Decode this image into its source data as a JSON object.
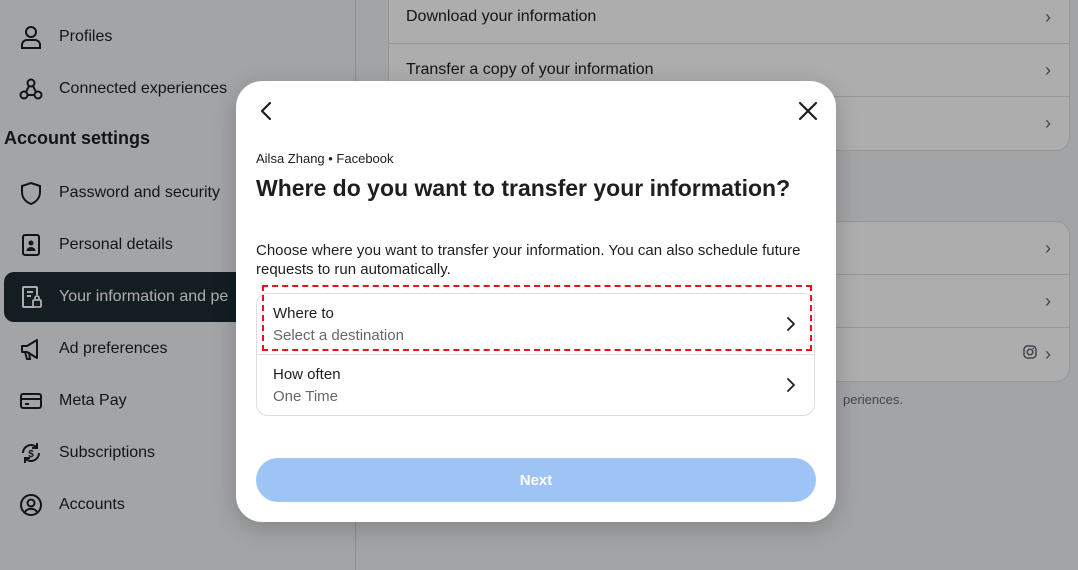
{
  "sidebar": {
    "items_top": [
      {
        "label": "Profiles",
        "icon": "person-icon"
      },
      {
        "label": "Connected experiences",
        "icon": "connected-experiences-icon"
      }
    ],
    "heading": "Account settings",
    "items": [
      {
        "label": "Password and security",
        "icon": "shield-icon"
      },
      {
        "label": "Personal details",
        "icon": "id-card-icon"
      },
      {
        "label": "Your information and pe",
        "icon": "document-lock-icon",
        "active": true
      },
      {
        "label": "Ad preferences",
        "icon": "megaphone-icon"
      },
      {
        "label": "Meta Pay",
        "icon": "credit-card-icon"
      },
      {
        "label": "Subscriptions",
        "icon": "dollar-refresh-icon"
      },
      {
        "label": "Accounts",
        "icon": "account-circle-icon"
      }
    ]
  },
  "content": {
    "card1_rows": [
      "Download your information",
      "Transfer a copy of your information",
      ""
    ],
    "card2_rows": [
      "",
      "",
      ""
    ],
    "note": "periences."
  },
  "modal": {
    "account": "Ailsa Zhang • Facebook",
    "title": "Where do you want to transfer your information?",
    "description": "Choose where you want to transfer your information. You can also schedule future requests to run automatically.",
    "options": [
      {
        "label": "Where to",
        "value": "Select a destination"
      },
      {
        "label": "How often",
        "value": "One Time"
      }
    ],
    "next_label": "Next"
  },
  "colors": {
    "active_sidebar_bg": "#1c2b33",
    "next_button_disabled": "#9ec4f5",
    "highlight_border": "#e5131b"
  }
}
